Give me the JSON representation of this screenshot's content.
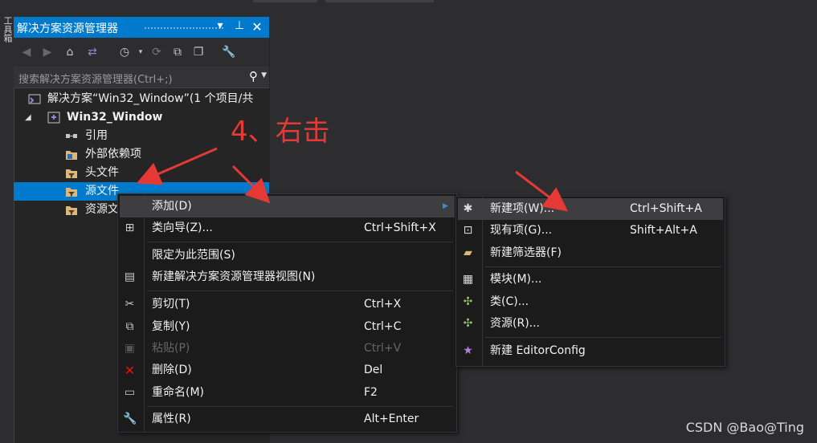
{
  "left_strip": {
    "text": "工具箱"
  },
  "panel": {
    "title": "解决方案资源管理器",
    "search_placeholder": "搜索解决方案资源管理器(Ctrl+;)"
  },
  "tree": [
    {
      "label": "解决方案“Win32_Window”(1 个项目/共"
    },
    {
      "label": "Win32_Window"
    },
    {
      "label": "引用"
    },
    {
      "label": "外部依赖项"
    },
    {
      "label": "头文件"
    },
    {
      "label": "源文件"
    },
    {
      "label": "资源文"
    }
  ],
  "annotation": "4、右击",
  "context_menu": [
    {
      "label": "添加(D)",
      "shortcut": ""
    },
    {
      "label": "类向导(Z)...",
      "shortcut": "Ctrl+Shift+X"
    },
    {
      "label": "限定为此范围(S)",
      "shortcut": ""
    },
    {
      "label": "新建解决方案资源管理器视图(N)",
      "shortcut": ""
    },
    {
      "label": "剪切(T)",
      "shortcut": "Ctrl+X"
    },
    {
      "label": "复制(Y)",
      "shortcut": "Ctrl+C"
    },
    {
      "label": "粘贴(P)",
      "shortcut": "Ctrl+V"
    },
    {
      "label": "删除(D)",
      "shortcut": "Del"
    },
    {
      "label": "重命名(M)",
      "shortcut": "F2"
    },
    {
      "label": "属性(R)",
      "shortcut": "Alt+Enter"
    }
  ],
  "submenu": [
    {
      "label": "新建项(W)...",
      "shortcut": "Ctrl+Shift+A"
    },
    {
      "label": "现有项(G)...",
      "shortcut": "Shift+Alt+A"
    },
    {
      "label": "新建筛选器(F)",
      "shortcut": ""
    },
    {
      "label": "模块(M)...",
      "shortcut": ""
    },
    {
      "label": "类(C)...",
      "shortcut": ""
    },
    {
      "label": "资源(R)...",
      "shortcut": ""
    },
    {
      "label": "新建 EditorConfig",
      "shortcut": ""
    }
  ],
  "watermark": "CSDN @Bao@Ting",
  "colors": {
    "accent": "#007acc",
    "annotation": "#e53935",
    "menu_bg": "#1b1b1c"
  }
}
